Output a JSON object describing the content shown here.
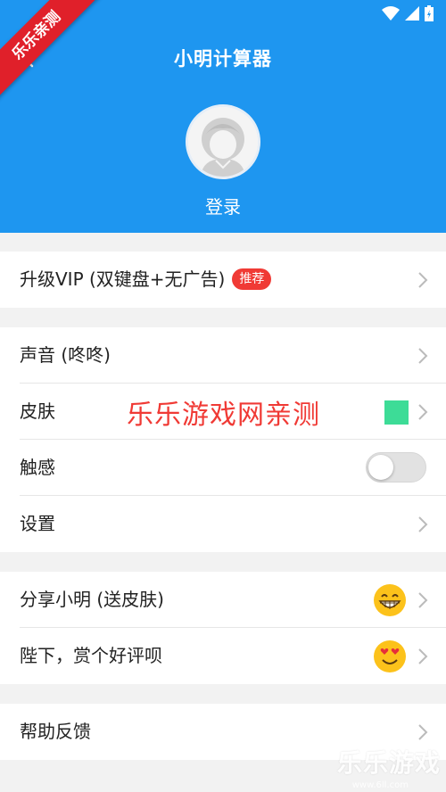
{
  "app": {
    "title": "小明计算器",
    "login_label": "登录"
  },
  "ribbon": {
    "text": "乐乐亲测"
  },
  "menu": {
    "upgrade": {
      "label": "升级VIP (双键盘+无广告)",
      "badge": "推荐"
    },
    "sound": {
      "label": "声音 (咚咚)"
    },
    "skin": {
      "label": "皮肤",
      "swatch_color": "#3ddc97"
    },
    "haptic": {
      "label": "触感",
      "toggle_on": false
    },
    "settings": {
      "label": "设置"
    },
    "share": {
      "label": "分享小明 (送皮肤)",
      "emoji": "grin-emoji-icon"
    },
    "rate": {
      "label": "陛下，赏个好评呗",
      "emoji": "heart-eyes-emoji-icon"
    },
    "help": {
      "label": "帮助反馈"
    }
  },
  "watermark": {
    "center": "乐乐游戏网亲测",
    "corner": "乐乐游戏",
    "url": "www.6ll.com"
  },
  "colors": {
    "header_bg": "#1e96f0",
    "badge_bg": "#f03a35",
    "ribbon_bg": "#e0202a"
  }
}
